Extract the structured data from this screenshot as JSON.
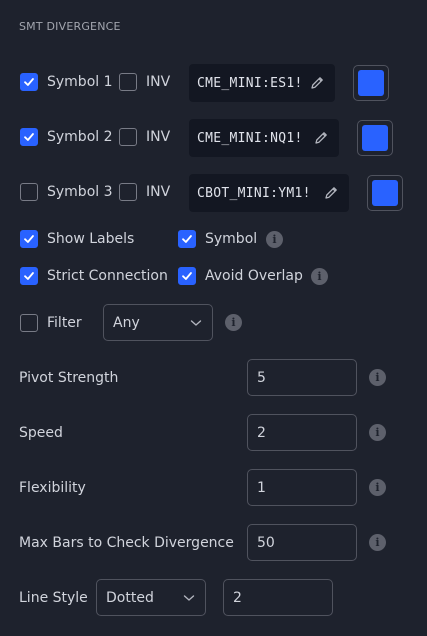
{
  "section_title": "SMT DIVERGENCE",
  "symbols": [
    {
      "enabled_label": "Symbol 1",
      "enabled": true,
      "inv_label": "INV",
      "inv": false,
      "ticker": "CME_MINI:ES1!",
      "color": "#2962ff"
    },
    {
      "enabled_label": "Symbol 2",
      "enabled": true,
      "inv_label": "INV",
      "inv": false,
      "ticker": "CME_MINI:NQ1!",
      "color": "#2962ff"
    },
    {
      "enabled_label": "Symbol 3",
      "enabled": false,
      "inv_label": "INV",
      "inv": false,
      "ticker": "CBOT_MINI:YM1!",
      "color": "#2962ff"
    }
  ],
  "options": {
    "show_labels": {
      "label": "Show Labels",
      "checked": true
    },
    "symbol": {
      "label": "Symbol",
      "checked": true
    },
    "strict_connection": {
      "label": "Strict Connection",
      "checked": true
    },
    "avoid_overlap": {
      "label": "Avoid Overlap",
      "checked": true
    },
    "filter": {
      "label": "Filter",
      "checked": false,
      "value": "Any"
    }
  },
  "inputs": {
    "pivot_strength": {
      "label": "Pivot Strength",
      "value": "5"
    },
    "speed": {
      "label": "Speed",
      "value": "2"
    },
    "flexibility": {
      "label": "Flexibility",
      "value": "1"
    },
    "max_bars": {
      "label": "Max Bars to Check Divergence",
      "value": "50"
    }
  },
  "line_style": {
    "label": "Line Style",
    "value": "Dotted",
    "width": "2"
  },
  "colors": {
    "accent": "#2962ff",
    "background": "#1e222d",
    "field_bg": "#131722"
  },
  "icons": {
    "check": "check-icon",
    "pencil": "pencil-icon",
    "info": "info-icon",
    "chevron": "chevron-down-icon"
  }
}
